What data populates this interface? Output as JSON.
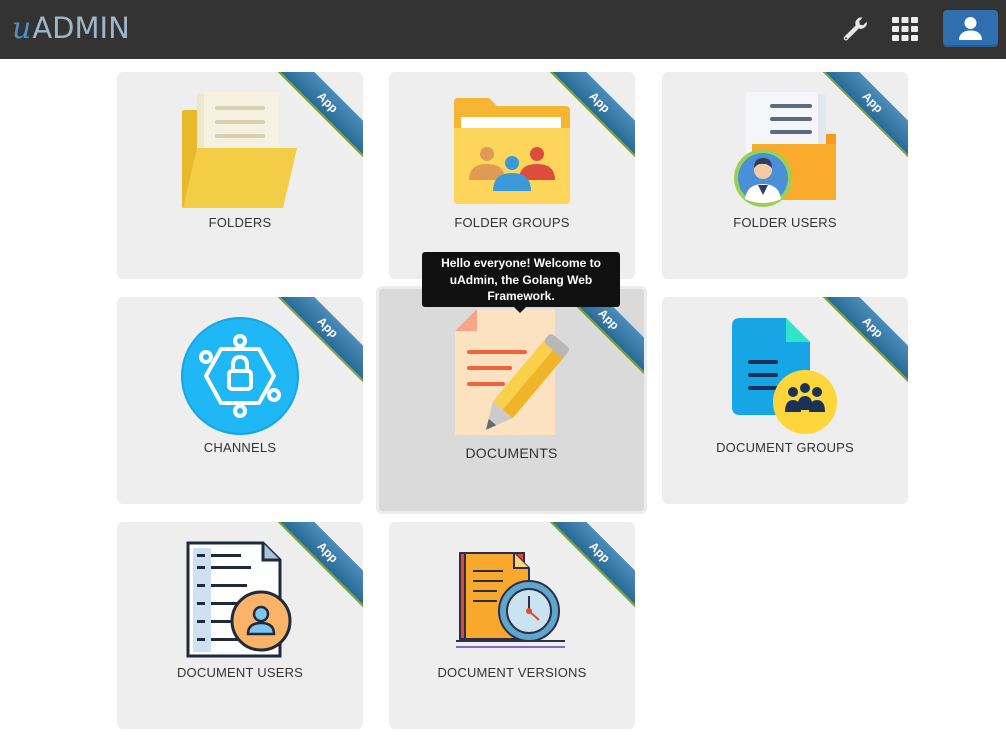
{
  "header": {
    "logo_u": "u",
    "logo_rest": "ADMIN",
    "icons": [
      "wrench-icon",
      "grid-icon",
      "user-icon"
    ]
  },
  "apps": [
    {
      "label": "FOLDERS",
      "badge": "App",
      "icon": "folder-icon"
    },
    {
      "label": "FOLDER GROUPS",
      "badge": "App",
      "icon": "folder-group-icon"
    },
    {
      "label": "FOLDER USERS",
      "badge": "App",
      "icon": "folder-user-icon"
    },
    {
      "label": "CHANNELS",
      "badge": "App",
      "icon": "channel-icon"
    },
    {
      "label": "DOCUMENTS",
      "badge": "App",
      "icon": "document-icon"
    },
    {
      "label": "DOCUMENT GROUPS",
      "badge": "App",
      "icon": "document-group-icon"
    },
    {
      "label": "DOCUMENT USERS",
      "badge": "App",
      "icon": "document-user-icon"
    },
    {
      "label": "DOCUMENT VERSIONS",
      "badge": "App",
      "icon": "document-version-icon"
    }
  ],
  "tooltip": {
    "text": "Hello everyone! Welcome to uAdmin, the Golang Web Framework."
  },
  "colors": {
    "navbar": "#333333",
    "card": "#eeeeee",
    "card_hover": "#dadada",
    "ribbon": "#3a7cab",
    "user_button": "#2f6fad"
  }
}
